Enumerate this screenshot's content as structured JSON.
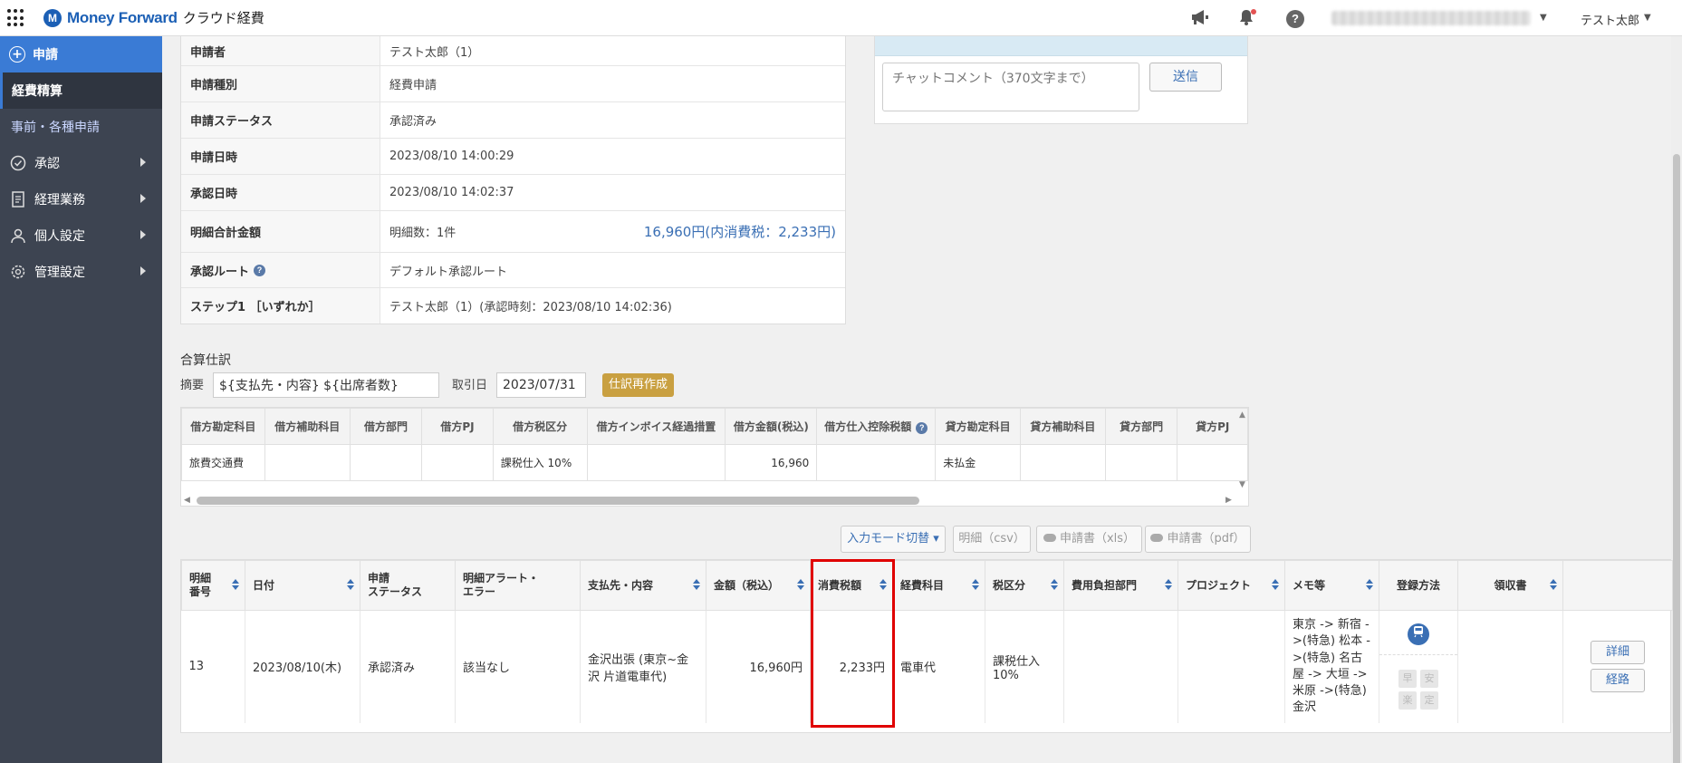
{
  "app": {
    "brand_mark": "M",
    "brand_name": "Money Forward",
    "product_name": "クラウド経費",
    "user_name": "テスト太郎"
  },
  "sidebar": {
    "new_label": "申請",
    "sub_items": [
      "経費精算",
      "事前・各種申請"
    ],
    "items": [
      {
        "label": "承認",
        "icon": "check-circle-icon"
      },
      {
        "label": "経理業務",
        "icon": "document-icon"
      },
      {
        "label": "個人設定",
        "icon": "person-icon"
      },
      {
        "label": "管理設定",
        "icon": "gear-icon"
      }
    ]
  },
  "detail": {
    "rows": [
      {
        "label": "申請者",
        "value": "テスト太郎（1）"
      },
      {
        "label": "申請種別",
        "value": "経費申請"
      },
      {
        "label": "申請ステータス",
        "value": "承認済み"
      },
      {
        "label": "申請日時",
        "value": "2023/08/10 14:00:29"
      },
      {
        "label": "承認日時",
        "value": "2023/08/10 14:02:37"
      },
      {
        "label": "明細合計金額",
        "value": "明細数：1件",
        "amount": "16,960円(内消費税：2,233円)"
      },
      {
        "label": "承認ルート",
        "value": "デフォルト承認ルート"
      },
      {
        "label": "ステップ1 ［いずれか］",
        "value": "テスト太郎（1）(承認時刻：2023/08/10 14:02:36)"
      }
    ]
  },
  "chat": {
    "placeholder": "チャットコメント（370文字まで）",
    "send_label": "送信"
  },
  "journal": {
    "title": "合算仕訳",
    "summary_label": "摘要",
    "summary_value": "${支払先・内容} ${出席者数}",
    "date_label": "取引日",
    "date_value": "2023/07/31",
    "recreate_label": "仕訳再作成",
    "headers": [
      "借方勘定科目",
      "借方補助科目",
      "借方部門",
      "借方PJ",
      "借方税区分",
      "借方インボイス経過措置",
      "借方金額(税込)",
      "借方仕入控除税額",
      "貸方勘定科目",
      "貸方補助科目",
      "貸方部門",
      "貸方PJ"
    ],
    "row": [
      "旅費交通費",
      "",
      "",
      "",
      "課税仕入 10%",
      "",
      "16,960",
      "",
      "未払金",
      "",
      "",
      ""
    ]
  },
  "actions": {
    "input_mode": "入力モード切替 ▾",
    "csv": "明細（csv）",
    "xls": "申請書（xls）",
    "pdf": "申請書（pdf）"
  },
  "items": {
    "headers": [
      {
        "label": "明細\n番号",
        "sort": true
      },
      {
        "label": "日付",
        "sort": true
      },
      {
        "label": "申請\nステータス",
        "sort": false
      },
      {
        "label": "明細アラート・\nエラー",
        "sort": false
      },
      {
        "label": "支払先・内容",
        "sort": true
      },
      {
        "label": "金額（税込）",
        "sort": true
      },
      {
        "label": "消費税額",
        "sort": true
      },
      {
        "label": "経費科目",
        "sort": true
      },
      {
        "label": "税区分",
        "sort": true
      },
      {
        "label": "費用負担部門",
        "sort": true
      },
      {
        "label": "プロジェクト",
        "sort": true
      },
      {
        "label": "メモ等",
        "sort": true
      },
      {
        "label": "登録方法",
        "sort": false
      },
      {
        "label": "領収書",
        "sort": true
      },
      {
        "label": "",
        "sort": false
      }
    ],
    "row": {
      "no": "13",
      "date": "2023/08/10(木)",
      "status": "承認済み",
      "alert": "該当なし",
      "payee": "金沢出張 (東京~金沢 片道電車代)",
      "amount": "16,960円",
      "tax": "2,233円",
      "category": "電車代",
      "tax_type": "課税仕入 10%",
      "department": "",
      "project": "",
      "memo": "東京 -> 新宿 ->(特急) 松本 ->(特急) 名古屋 -> 大垣 -> 米原 ->(特急) 金沢",
      "reg_chars": [
        "早",
        "安",
        "楽",
        "定"
      ],
      "detail_btn": "詳細",
      "route_btn": "経路"
    }
  }
}
